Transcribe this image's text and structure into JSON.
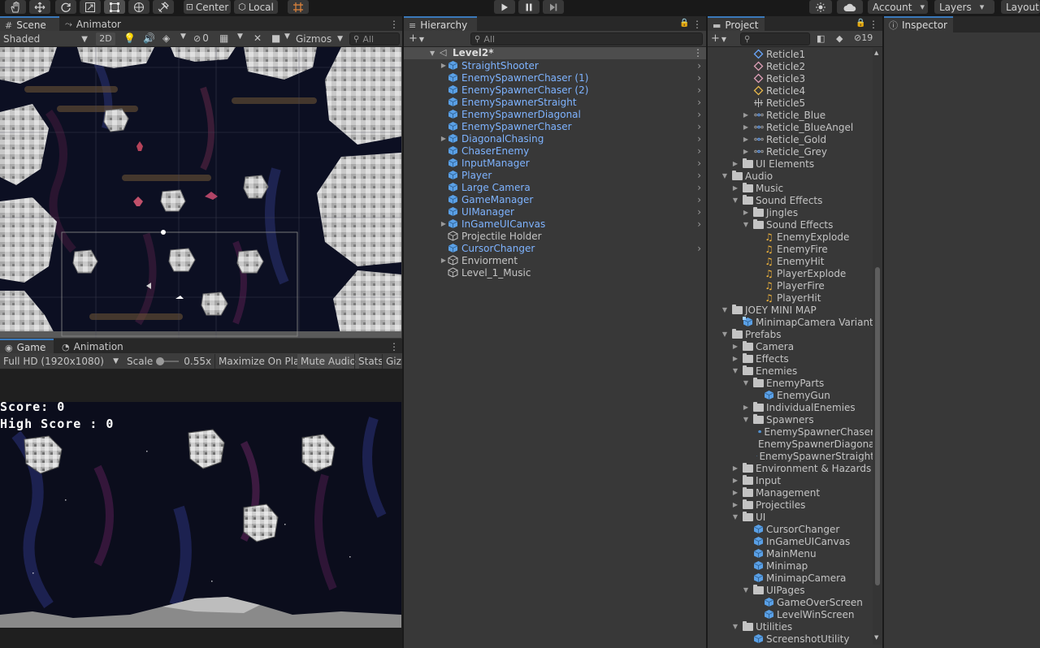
{
  "toolbar": {
    "tools": [
      "hand-tool-icon",
      "move-tool-icon",
      "rotate-tool-icon",
      "scale-tool-icon",
      "rect-tool-icon",
      "transform-tool-icon",
      "custom-tool-icon"
    ],
    "pivot_mode": "Center",
    "pivot_rotation": "Local",
    "account_label": "Account",
    "layers_label": "Layers",
    "layout_label": "Layout"
  },
  "scene_panel": {
    "tabs": [
      "Scene",
      "Animator"
    ],
    "shading_mode": "Shaded",
    "mode_2d": "2D",
    "hidden_count": "0",
    "gizmos_label": "Gizmos",
    "search_placeholder": "All"
  },
  "game_panel": {
    "tabs": [
      "Game",
      "Animation"
    ],
    "resolution": "Full HD (1920x1080)",
    "scale_label": "Scale",
    "scale_value": "0.55x",
    "maximize_label": "Maximize On Play",
    "mute_label": "Mute Audio",
    "stats_label": "Stats",
    "gizmos_partial": "Gizm",
    "score_text": "Score: 0",
    "high_score_text": "High Score : 0"
  },
  "hierarchy": {
    "tab": "Hierarchy",
    "search_placeholder": "All",
    "scene_name": "Level2*",
    "items": [
      {
        "label": "StraightShooter",
        "prefab": true,
        "foldable": true,
        "chevron": true
      },
      {
        "label": "EnemySpawnerChaser (1)",
        "prefab": true,
        "foldable": false,
        "chevron": true
      },
      {
        "label": "EnemySpawnerChaser (2)",
        "prefab": true,
        "foldable": false,
        "chevron": true
      },
      {
        "label": "EnemySpawnerStraight",
        "prefab": true,
        "foldable": false,
        "chevron": true
      },
      {
        "label": "EnemySpawnerDiagonal",
        "prefab": true,
        "foldable": false,
        "chevron": true
      },
      {
        "label": "EnemySpawnerChaser",
        "prefab": true,
        "foldable": false,
        "chevron": true
      },
      {
        "label": "DiagonalChasing",
        "prefab": true,
        "foldable": true,
        "chevron": true
      },
      {
        "label": "ChaserEnemy",
        "prefab": true,
        "foldable": false,
        "chevron": true
      },
      {
        "label": "InputManager",
        "prefab": true,
        "foldable": false,
        "chevron": true
      },
      {
        "label": "Player",
        "prefab": true,
        "foldable": false,
        "chevron": true
      },
      {
        "label": "Large Camera",
        "prefab": true,
        "foldable": false,
        "chevron": true
      },
      {
        "label": "GameManager",
        "prefab": true,
        "foldable": false,
        "chevron": true
      },
      {
        "label": "UIManager",
        "prefab": true,
        "foldable": false,
        "chevron": true
      },
      {
        "label": "InGameUICanvas",
        "prefab": true,
        "foldable": true,
        "chevron": true
      },
      {
        "label": "Projectile Holder",
        "prefab": false,
        "foldable": false,
        "chevron": false
      },
      {
        "label": "CursorChanger",
        "prefab": true,
        "foldable": false,
        "chevron": true
      },
      {
        "label": "Enviorment",
        "prefab": false,
        "foldable": true,
        "chevron": false
      },
      {
        "label": "Level_1_Music",
        "prefab": false,
        "foldable": false,
        "chevron": false
      }
    ]
  },
  "project": {
    "tab": "Project",
    "hidden_count": "19",
    "items": [
      {
        "label": "Reticle1",
        "depth": 3,
        "icon": "reticle-blue-icon",
        "fold": ""
      },
      {
        "label": "Reticle2",
        "depth": 3,
        "icon": "reticle-pink-icon",
        "fold": ""
      },
      {
        "label": "Reticle3",
        "depth": 3,
        "icon": "reticle-pink-icon",
        "fold": ""
      },
      {
        "label": "Reticle4",
        "depth": 3,
        "icon": "reticle-gold-icon",
        "fold": ""
      },
      {
        "label": "Reticle5",
        "depth": 3,
        "icon": "reticle-cross-icon",
        "fold": ""
      },
      {
        "label": "Reticle_Blue",
        "depth": 3,
        "icon": "sprite-sheet-icon",
        "fold": "closed"
      },
      {
        "label": "Reticle_BlueAngel",
        "depth": 3,
        "icon": "sprite-sheet-icon",
        "fold": "closed"
      },
      {
        "label": "Reticle_Gold",
        "depth": 3,
        "icon": "sprite-sheet-icon",
        "fold": "closed"
      },
      {
        "label": "Reticle_Grey",
        "depth": 3,
        "icon": "sprite-sheet-icon",
        "fold": "closed"
      },
      {
        "label": "UI Elements",
        "depth": 2,
        "icon": "folder-icon",
        "fold": "closed"
      },
      {
        "label": "Audio",
        "depth": 1,
        "icon": "folder-icon",
        "fold": "open"
      },
      {
        "label": "Music",
        "depth": 2,
        "icon": "folder-icon",
        "fold": "closed"
      },
      {
        "label": "Sound Effects",
        "depth": 2,
        "icon": "folder-icon",
        "fold": "open"
      },
      {
        "label": "Jingles",
        "depth": 3,
        "icon": "folder-icon",
        "fold": "closed"
      },
      {
        "label": "Sound Effects",
        "depth": 3,
        "icon": "folder-icon",
        "fold": "open"
      },
      {
        "label": "EnemyExplode",
        "depth": 4,
        "icon": "audio-clip-icon",
        "fold": ""
      },
      {
        "label": "EnemyFire",
        "depth": 4,
        "icon": "audio-clip-icon",
        "fold": ""
      },
      {
        "label": "EnemyHit",
        "depth": 4,
        "icon": "audio-clip-icon",
        "fold": ""
      },
      {
        "label": "PlayerExplode",
        "depth": 4,
        "icon": "audio-clip-icon",
        "fold": ""
      },
      {
        "label": "PlayerFire",
        "depth": 4,
        "icon": "audio-clip-icon",
        "fold": ""
      },
      {
        "label": "PlayerHit",
        "depth": 4,
        "icon": "audio-clip-icon",
        "fold": ""
      },
      {
        "label": "JOEY MINI MAP",
        "depth": 1,
        "icon": "folder-icon",
        "fold": "open"
      },
      {
        "label": "MinimapCamera Variant",
        "depth": 2,
        "icon": "prefab-variant-icon",
        "fold": ""
      },
      {
        "label": "Prefabs",
        "depth": 1,
        "icon": "folder-icon",
        "fold": "open"
      },
      {
        "label": "Camera",
        "depth": 2,
        "icon": "folder-icon",
        "fold": "closed"
      },
      {
        "label": "Effects",
        "depth": 2,
        "icon": "folder-icon",
        "fold": "closed"
      },
      {
        "label": "Enemies",
        "depth": 2,
        "icon": "folder-icon",
        "fold": "open"
      },
      {
        "label": "EnemyParts",
        "depth": 3,
        "icon": "folder-icon",
        "fold": "open"
      },
      {
        "label": "EnemyGun",
        "depth": 4,
        "icon": "prefab-icon",
        "fold": ""
      },
      {
        "label": "IndividualEnemies",
        "depth": 3,
        "icon": "folder-icon",
        "fold": "closed"
      },
      {
        "label": "Spawners",
        "depth": 3,
        "icon": "folder-icon",
        "fold": "open"
      },
      {
        "label": "EnemySpawnerChaser",
        "depth": 4,
        "icon": "prefab-icon",
        "fold": ""
      },
      {
        "label": "EnemySpawnerDiagonal",
        "depth": 4,
        "icon": "prefab-icon",
        "fold": ""
      },
      {
        "label": "EnemySpawnerStraight",
        "depth": 4,
        "icon": "prefab-icon",
        "fold": ""
      },
      {
        "label": "Environment & Hazards",
        "depth": 2,
        "icon": "folder-icon",
        "fold": "closed"
      },
      {
        "label": "Input",
        "depth": 2,
        "icon": "folder-icon",
        "fold": "closed"
      },
      {
        "label": "Management",
        "depth": 2,
        "icon": "folder-icon",
        "fold": "closed"
      },
      {
        "label": "Projectiles",
        "depth": 2,
        "icon": "folder-icon",
        "fold": "closed"
      },
      {
        "label": "UI",
        "depth": 2,
        "icon": "folder-icon",
        "fold": "open"
      },
      {
        "label": "CursorChanger",
        "depth": 3,
        "icon": "prefab-icon",
        "fold": ""
      },
      {
        "label": "InGameUICanvas",
        "depth": 3,
        "icon": "prefab-icon",
        "fold": ""
      },
      {
        "label": "MainMenu",
        "depth": 3,
        "icon": "prefab-icon",
        "fold": ""
      },
      {
        "label": "Minimap",
        "depth": 3,
        "icon": "prefab-icon",
        "fold": ""
      },
      {
        "label": "MinimapCamera",
        "depth": 3,
        "icon": "prefab-icon",
        "fold": ""
      },
      {
        "label": "UIPages",
        "depth": 3,
        "icon": "folder-icon",
        "fold": "open"
      },
      {
        "label": "GameOverScreen",
        "depth": 4,
        "icon": "prefab-icon",
        "fold": ""
      },
      {
        "label": "LevelWinScreen",
        "depth": 4,
        "icon": "prefab-icon",
        "fold": ""
      },
      {
        "label": "Utilities",
        "depth": 2,
        "icon": "folder-icon",
        "fold": "open"
      },
      {
        "label": "ScreenshotUtility",
        "depth": 3,
        "icon": "prefab-icon",
        "fold": ""
      }
    ]
  },
  "inspector": {
    "tab": "Inspector"
  },
  "colors": {
    "accent_blue": "#3a79bb",
    "prefab_text": "#7eb3ff",
    "audio_icon": "#f0b43c"
  }
}
